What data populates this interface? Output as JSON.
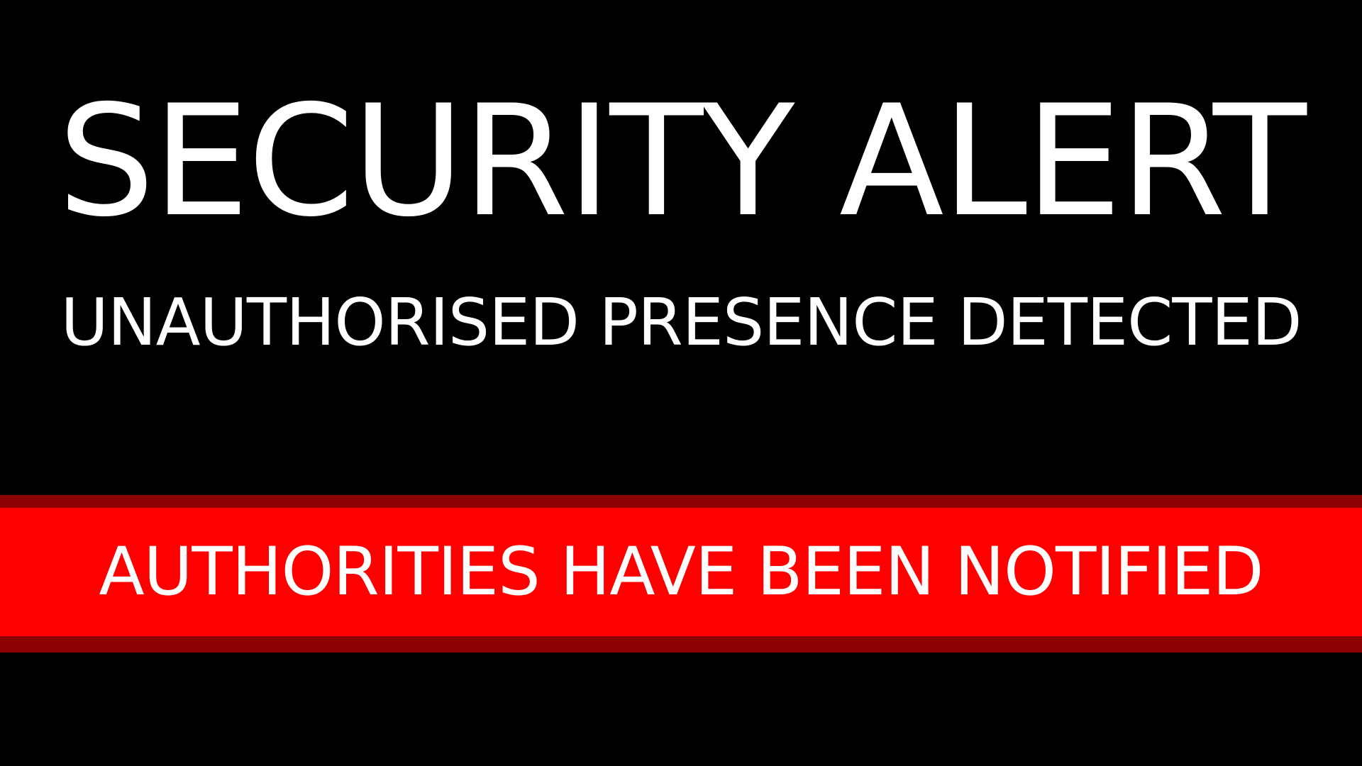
{
  "alert": {
    "title": "SECURITY ALERT",
    "subtitle": "UNAUTHORISED PRESENCE DETECTED",
    "banner_text": "AUTHORITIES HAVE BEEN NOTIFIED"
  },
  "colors": {
    "background": "#000000",
    "text": "#ffffff",
    "banner": "#ff0000",
    "banner_border": "#8b0000"
  }
}
